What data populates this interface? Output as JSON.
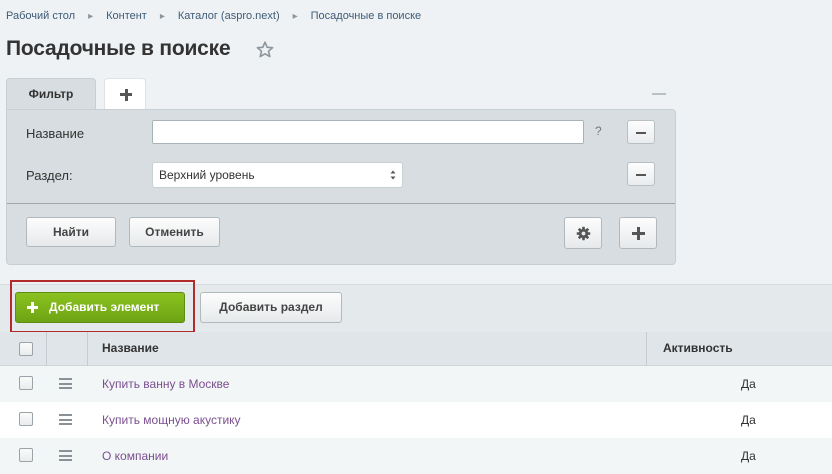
{
  "breadcrumb": [
    "Рабочий стол",
    "Контент",
    "Каталог (aspro.next)",
    "Посадочные в поиске"
  ],
  "page": {
    "title": "Посадочные в поиске",
    "favorite_icon": "star-icon"
  },
  "filter": {
    "tab_label": "Фильтр",
    "add_tab_icon": "plus-icon",
    "fields": {
      "name_label": "Название",
      "name_value": "",
      "help": "?",
      "section_label": "Раздел:",
      "section_value": "Верхний уровень"
    },
    "find_label": "Найти",
    "cancel_label": "Отменить"
  },
  "toolbar": {
    "add_element_label": "Добавить элемент",
    "add_section_label": "Добавить раздел",
    "accent": "#7ab317",
    "highlight": "#b22a2a"
  },
  "table": {
    "columns": [
      "Название",
      "Активность"
    ],
    "rows": [
      {
        "name": "Купить ванну в Москве",
        "active": "Да"
      },
      {
        "name": "Купить мощную акустику",
        "active": "Да"
      },
      {
        "name": "О компании",
        "active": "Да"
      }
    ]
  }
}
